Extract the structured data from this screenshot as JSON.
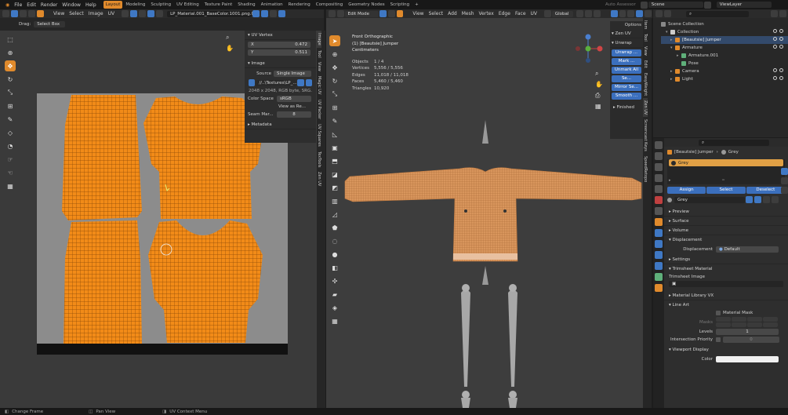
{
  "colors": {
    "accent": "#e08a2c",
    "blue": "#3f78c4",
    "uv_fill": "#f28b18",
    "viewport_bg": "#3d3d3d",
    "uv_bg": "#8c8c8c"
  },
  "topbar": {
    "menus": [
      "File",
      "Edit",
      "Render",
      "Window",
      "Help"
    ],
    "workspaces": [
      "Layout",
      "Modeling",
      "Sculpting",
      "UV Editing",
      "Texture Paint",
      "Shading",
      "Animation",
      "Rendering",
      "Compositing",
      "Geometry Nodes",
      "Scripting"
    ],
    "active_workspace": "Layout",
    "scene_prefix": "Auto Assessor",
    "scene": "Scene",
    "view_layer": "ViewLayer"
  },
  "uv_editor": {
    "menus": [
      "View",
      "Select",
      "Image",
      "UV"
    ],
    "image_name": "LP_Material.001_BaseColor.1001.png.005",
    "drag_label": "Drag:",
    "drag_value": "Select Box",
    "tabs": [
      "Image",
      "Tool",
      "View",
      "Magic UV",
      "UV Packer",
      "UV Squares",
      "TexTools",
      "Zen UV"
    ],
    "uv_vertex_title": "UV Vertex",
    "x_label": "X",
    "x_value": "0.472",
    "y_label": "Y",
    "y_value": "0.511",
    "image_title": "Image",
    "source_label": "Source",
    "source_value": "Single Image",
    "image_path": "//..\\Textures\\LP_...",
    "image_info": "2048 x 2048,  RGB byte, SRG...",
    "colorspace_label": "Color Space",
    "colorspace_value": "sRGB",
    "view_as_render": "View as Re...",
    "seam_margin_label": "Seam Mar...",
    "seam_margin_value": "8",
    "metadata_title": "Metadata"
  },
  "viewport": {
    "mode": "Edit Mode",
    "menus": [
      "View",
      "Select",
      "Add",
      "Mesh",
      "Vertex",
      "Edge",
      "Face",
      "UV"
    ],
    "transform": "Global",
    "view_name": "Front Orthographic",
    "object_name": "(1) [Beautsie] Jumper",
    "units": "Centimeters",
    "stats": [
      {
        "label": "Objects",
        "value": "1 / 4"
      },
      {
        "label": "Vertices",
        "value": "5,556 / 5,556"
      },
      {
        "label": "Edges",
        "value": "11,018 / 11,018"
      },
      {
        "label": "Faces",
        "value": "5,460 / 5,460"
      },
      {
        "label": "Triangles",
        "value": "10,920"
      }
    ],
    "options_label": "Options",
    "zen_uv": "Zen UV",
    "unwrap": "Unwrap",
    "zen_buttons": [
      "Unwrap ...",
      "Mark ...",
      "Unmark All",
      "Se...",
      "Mirror Se...",
      "Smooth ..."
    ],
    "finished": "Finished",
    "side_tabs": [
      "Item",
      "Tool",
      "View",
      "Edit",
      "EasyWeight",
      "Zen UV",
      "Screencast Keys",
      "SpeedRetopo"
    ]
  },
  "outliner": {
    "title": "Scene Collection",
    "rows": [
      {
        "label": "Collection",
        "indent": 0,
        "color": "#cfcfcf"
      },
      {
        "label": "[Beautsie] Jumper",
        "indent": 1,
        "color": "#e08a2c"
      },
      {
        "label": "Armature",
        "indent": 1,
        "color": "#e08a2c"
      },
      {
        "label": "Armature.001",
        "indent": 2,
        "color": "#5fb07a"
      },
      {
        "label": "Pose",
        "indent": 2,
        "color": "#5fb07a"
      },
      {
        "label": "Camera",
        "indent": 1,
        "color": "#e08a2c"
      },
      {
        "label": "Light",
        "indent": 1,
        "color": "#e08a2c"
      }
    ]
  },
  "properties": {
    "breadcrumb_object": "[Beautsie] Jumper",
    "breadcrumb_material": "Grey",
    "slot_name": "Grey",
    "assign": "Assign",
    "select": "Select",
    "deselect": "Deselect",
    "material_name": "Grey",
    "sections": [
      "Preview",
      "Surface",
      "Volume"
    ],
    "displacement_title": "Displacement",
    "displacement_label": "Displacement",
    "displacement_value": "Default",
    "settings": "Settings",
    "trimsheet_title": "Trimsheet Material",
    "trimsheet_image": "Trimsheet Image",
    "material_library": "Material Library VX",
    "line_art": "Line Art",
    "material_mask": "Material Mask",
    "masks_label": "Masks",
    "levels_label": "Levels",
    "levels_value": "1",
    "intersection_label": "Intersection Priority",
    "intersection_value": "0",
    "viewport_display": "Viewport Display",
    "color_label": "Color"
  },
  "statusbar": {
    "items": [
      "Change Frame",
      "Pan View",
      "UV Context Menu"
    ]
  }
}
